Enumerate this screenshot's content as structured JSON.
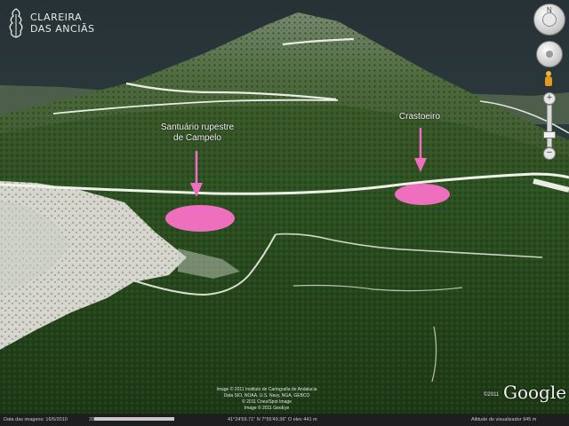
{
  "brand": {
    "line1": "CLAREIRA",
    "line2": "DAS ANCIÃS",
    "logo_icon": "tree-spiral-logo"
  },
  "labels": {
    "santuario": [
      "Santuário rupestre",
      "de Campelo"
    ],
    "crasto": "Crastoeiro"
  },
  "markers": {
    "color": "#ee6fbd"
  },
  "credits": [
    "Image © 2011 Instituto de Cartografia de Andalucia",
    "Data SIO, NOAA, U.S. Navy, NGA, GEBCO",
    "© 2011 Cnes/Spot Image",
    "Image © 2011 GeoEye"
  ],
  "logo": {
    "prefix": "©2011",
    "name": "Google"
  },
  "status": {
    "imagery_date": "Data das imagens: 16/5/2010",
    "streaming_percent": "2007",
    "coords": "41°24'59.71\" N   7°55'49.36\" O  elev  441 m",
    "eye_alt": "Altitude do visualizador  945 m",
    "stream_fill": 1.0
  },
  "nav": {
    "north_label": "N"
  }
}
